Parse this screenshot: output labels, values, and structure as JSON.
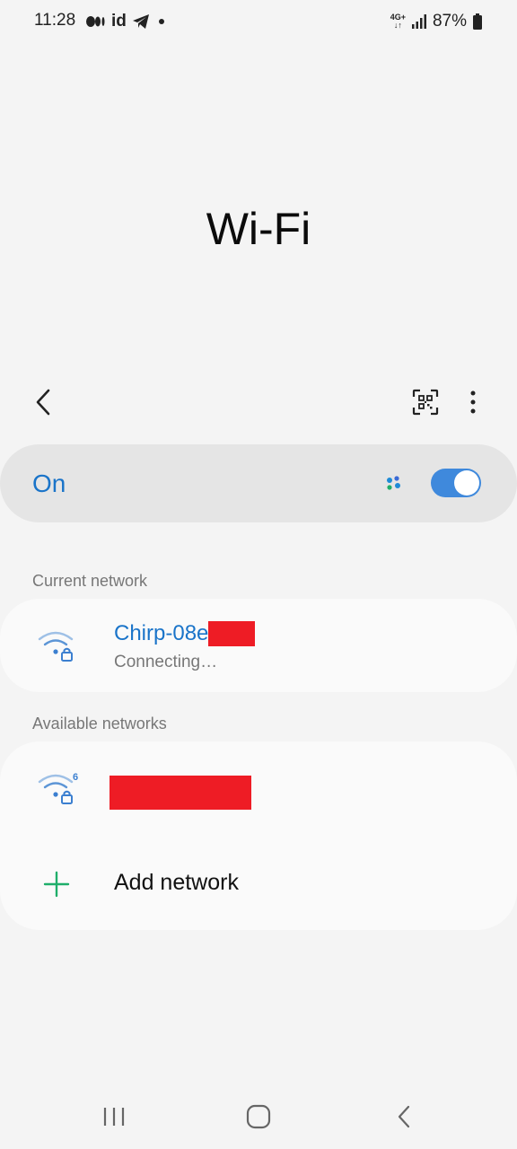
{
  "status_bar": {
    "time": "11:28",
    "network_type": "4G+",
    "battery": "87%"
  },
  "title": "Wi-Fi",
  "toolbar": {
    "back_icon": "back-arrow-icon",
    "qr_icon": "qr-scan-icon",
    "more_icon": "more-vertical-icon"
  },
  "master_switch": {
    "label": "On",
    "state": true,
    "accent_color": "#3f89dc"
  },
  "current_network": {
    "header": "Current network",
    "name": "Chirp-08e",
    "status": "Connecting…"
  },
  "available_networks": {
    "header": "Available networks",
    "items": [
      {
        "name_redacted": true,
        "wifi_badge": "6",
        "secured": true
      }
    ],
    "add_label": "Add network"
  },
  "nav": {
    "recents_icon": "recents-icon",
    "home_icon": "home-icon",
    "back_icon": "back-icon"
  }
}
